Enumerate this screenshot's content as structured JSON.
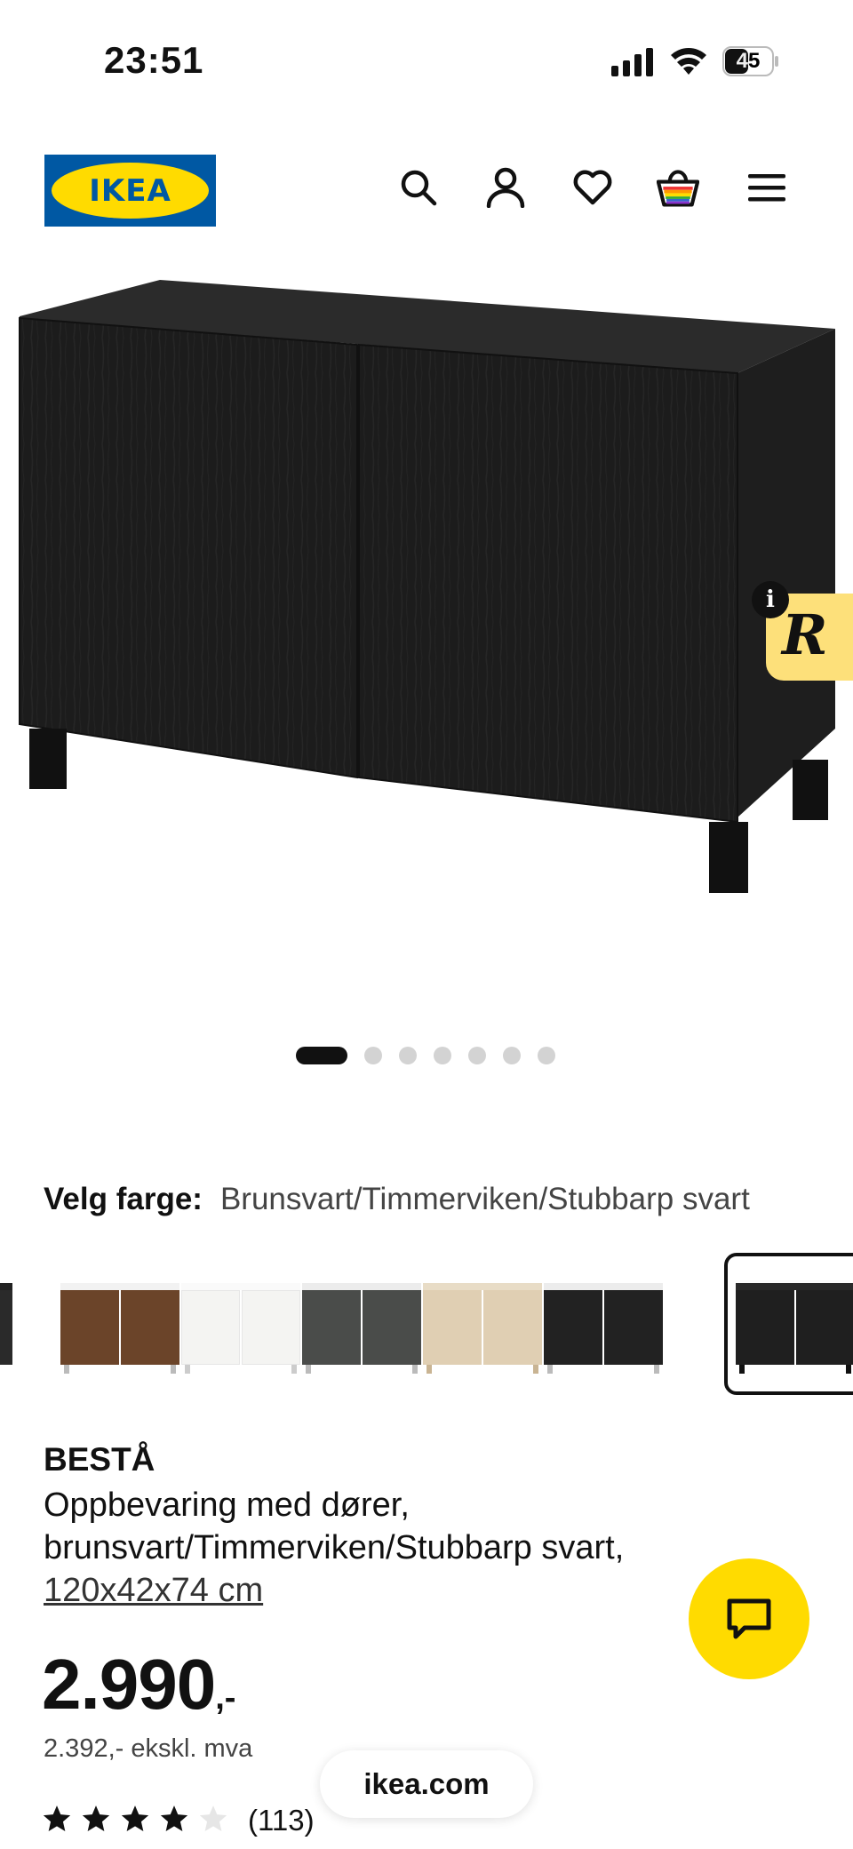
{
  "status_bar": {
    "time": "23:51",
    "battery": "45"
  },
  "header": {
    "logo_text": "IKEA",
    "icons": [
      "search-icon",
      "account-icon",
      "heart-icon",
      "basket-icon",
      "menu-icon"
    ]
  },
  "gallery": {
    "image_count": 7,
    "active_index": 0
  },
  "extension": {
    "letter": "R",
    "info": "i"
  },
  "color_select": {
    "label": "Velg farge:",
    "value": "Brunsvart/Timmerviken/Stubbarp svart"
  },
  "swatches": [
    {
      "name": "black-partial",
      "door": "#2a2a2a"
    },
    {
      "name": "walnut",
      "door": "#6b4429"
    },
    {
      "name": "white",
      "door": "#f4f4f2"
    },
    {
      "name": "dark-grey",
      "door": "#4a4c4a"
    },
    {
      "name": "oak",
      "door": "#e0cfb3"
    },
    {
      "name": "black-brown",
      "door": "#1f1f1f",
      "selected": true
    }
  ],
  "product": {
    "name": "BESTÅ",
    "description": "Oppbevaring med dører, brunsvart/Timmerviken/Stubbarp svart,",
    "size": "120x42x74 cm",
    "price_main": "2.990",
    "price_suffix": ",-",
    "price_ex_vat": "2.392,- ekskl. mva",
    "rating": 4,
    "rating_count": "(113)"
  },
  "browser": {
    "domain": "ikea.com"
  },
  "colors": {
    "brand_blue": "#0058a3",
    "brand_yellow": "#ffdb00"
  }
}
